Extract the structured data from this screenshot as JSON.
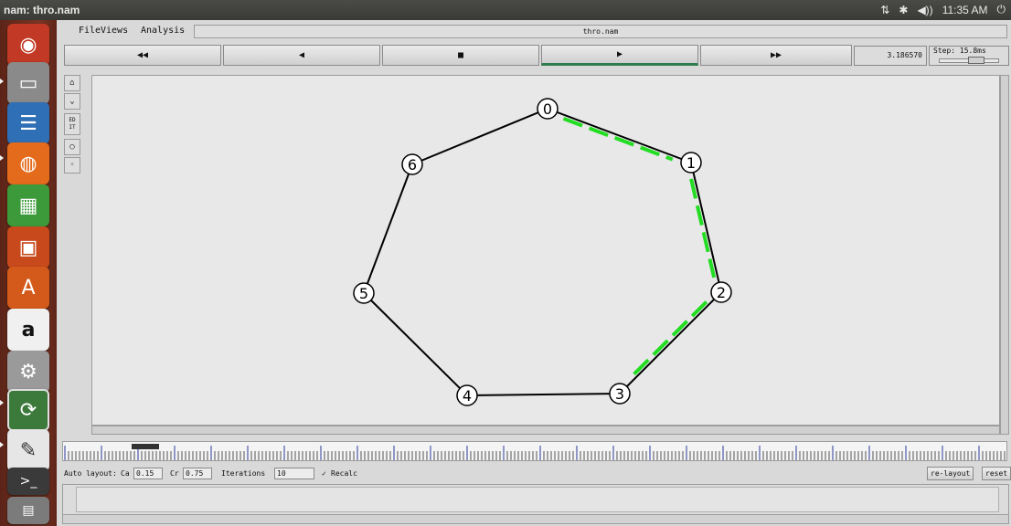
{
  "window": {
    "title": "nam: thro.nam"
  },
  "tray": {
    "clock": "11:35 AM",
    "network_icon": "network-icon",
    "bluetooth_icon": "bluetooth-icon",
    "volume_icon": "volume-icon",
    "power_icon": "power-icon"
  },
  "menus": {
    "file": "File",
    "views": "Views",
    "analysis": "Analysis"
  },
  "file_label": "thro.nam",
  "controls": {
    "rewind": "◀◀",
    "back": "◀",
    "stop": "■",
    "play": "▶",
    "forward": "▶▶"
  },
  "time_value": "3.186570",
  "step_label": "Step: 15.8ms",
  "tools": {
    "edit": "ED IT"
  },
  "autolayout": {
    "label": "Auto layout:",
    "ca_label": "Ca",
    "ca_value": "0.15",
    "cr_label": "Cr",
    "cr_value": "0.75",
    "iterations_label": "Iterations",
    "iterations_value": "10",
    "recalc_label": "Recalc",
    "recalc_checked": true,
    "relayout_button": "re-layout",
    "reset_button": "reset"
  },
  "timeline_marker": "1.0000",
  "colors": {
    "link": "#000000",
    "active_flow": "#22dd22",
    "canvas_bg": "#e8e8e8",
    "launcher": "#6a2a1c"
  },
  "graph": {
    "nodes": [
      "0",
      "1",
      "2",
      "3",
      "4",
      "5",
      "6"
    ],
    "links": [
      [
        "0",
        "1"
      ],
      [
        "1",
        "2"
      ],
      [
        "2",
        "3"
      ],
      [
        "3",
        "4"
      ],
      [
        "4",
        "5"
      ],
      [
        "5",
        "6"
      ],
      [
        "6",
        "0"
      ]
    ],
    "active_links": [
      [
        "0",
        "1"
      ],
      [
        "1",
        "2"
      ],
      [
        "2",
        "3"
      ]
    ]
  },
  "launcher_items": [
    "ubuntu-dash-icon",
    "files-icon",
    "writer-icon",
    "firefox-icon",
    "calc-icon",
    "impress-icon",
    "software-center-icon",
    "amazon-icon",
    "system-settings-icon",
    "software-updater-icon",
    "text-editor-icon",
    "terminal-icon",
    "workspaces-icon"
  ]
}
